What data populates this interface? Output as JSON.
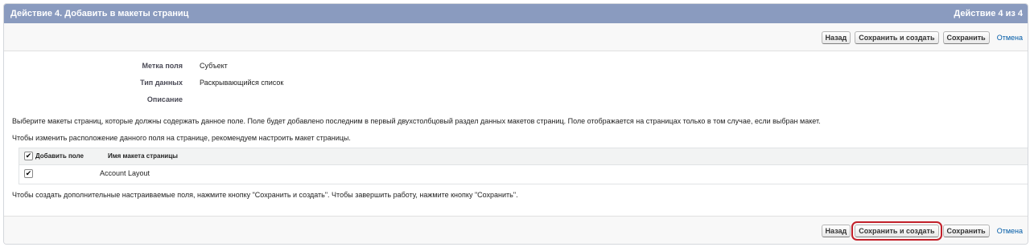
{
  "header": {
    "title": "Действие 4. Добавить в макеты страниц",
    "step": "Действие 4 из 4"
  },
  "buttons": {
    "back": "Назад",
    "save_and_new": "Сохранить и создать",
    "save": "Сохранить",
    "cancel": "Отмена"
  },
  "fields": {
    "label_title": "Метка поля",
    "label_value": "Субъект",
    "type_title": "Тип данных",
    "type_value": "Раскрывающийся список",
    "desc_title": "Описание",
    "desc_value": ""
  },
  "instructions": {
    "select": "Выберите макеты страниц, которые должны содержать данное поле. Поле будет добавлено последним в первый двухстолбцовый раздел данных макетов страниц. Поле отображается на страницах только в том случае, если выбран макет.",
    "reorder": "Чтобы изменить расположение данного поля на странице, рекомендуем настроить макет страницы.",
    "finish": "Чтобы создать дополнительные настраиваемые поля, нажмите кнопку \"Сохранить и создать\". Чтобы завершить работу, нажмите кнопку \"Сохранить\"."
  },
  "table": {
    "col_add": "Добавить поле",
    "col_name": "Имя макета страницы",
    "rows": [
      {
        "checked": true,
        "name": "Account Layout"
      }
    ]
  },
  "colors": {
    "header_bg": "#8a9bbf",
    "highlight": "#c2202a",
    "link": "#015ba7"
  }
}
